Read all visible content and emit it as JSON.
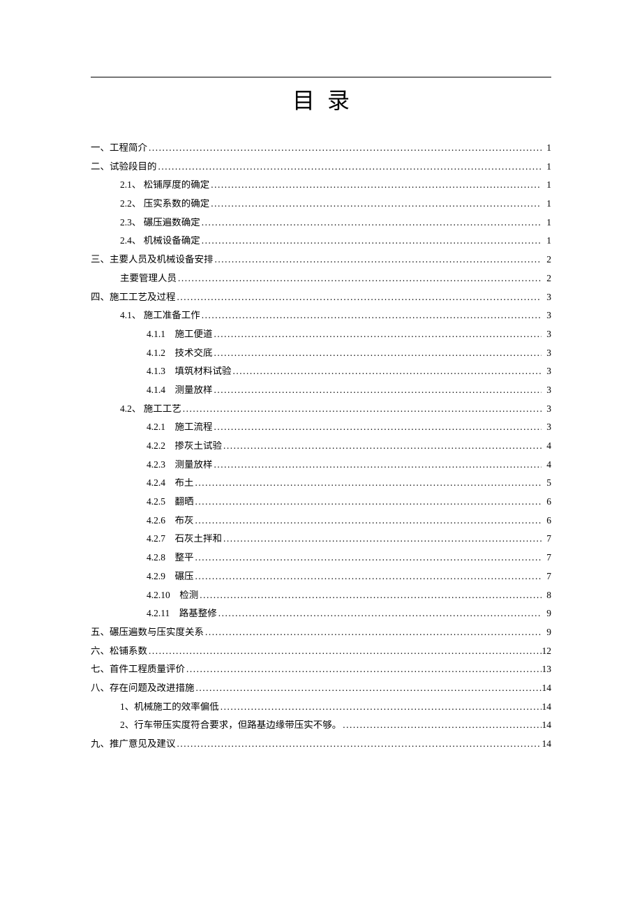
{
  "title": "目录",
  "toc": [
    {
      "level": 0,
      "label": "一、工程简介",
      "page": "1"
    },
    {
      "level": 0,
      "label": "二、试验段目的",
      "page": "1"
    },
    {
      "level": 1,
      "label": "2.1、 松铺厚度的确定",
      "page": "1"
    },
    {
      "level": 1,
      "label": "2.2、 压实系数的确定",
      "page": "1"
    },
    {
      "level": 1,
      "label": "2.3、 碾压遍数确定",
      "page": "1"
    },
    {
      "level": 1,
      "label": "2.4、 机械设备确定",
      "page": "1"
    },
    {
      "level": 0,
      "label": "三、主要人员及机械设备安排",
      "page": "2"
    },
    {
      "level": 1,
      "label": "主要管理人员",
      "page": "2"
    },
    {
      "level": 0,
      "label": "四、施工工艺及过程",
      "page": "3"
    },
    {
      "level": 1,
      "label": "4.1、  施工准备工作",
      "page": "3"
    },
    {
      "level": 2,
      "label": "4.1.1　施工便道",
      "page": "3"
    },
    {
      "level": 2,
      "label": "4.1.2　技术交底",
      "page": "3"
    },
    {
      "level": 2,
      "label": "4.1.3　填筑材料试验",
      "page": "3"
    },
    {
      "level": 2,
      "label": "4.1.4　测量放样",
      "page": "3"
    },
    {
      "level": 1,
      "label": "4.2、  施工工艺",
      "page": "3"
    },
    {
      "level": 2,
      "label": "4.2.1　施工流程",
      "page": "3"
    },
    {
      "level": 2,
      "label": "4.2.2　掺灰土试验",
      "page": "4"
    },
    {
      "level": 2,
      "label": "4.2.3　测量放样",
      "page": "4"
    },
    {
      "level": 2,
      "label": "4.2.4　布土",
      "page": "5"
    },
    {
      "level": 2,
      "label": "4.2.5　翻晒",
      "page": "6"
    },
    {
      "level": 2,
      "label": "4.2.6　布灰",
      "page": "6"
    },
    {
      "level": 2,
      "label": "4.2.7　石灰土拌和",
      "page": "7"
    },
    {
      "level": 2,
      "label": "4.2.8　整平",
      "page": "7"
    },
    {
      "level": 2,
      "label": "4.2.9　碾压",
      "page": "7"
    },
    {
      "level": 2,
      "label": "4.2.10　检测",
      "page": "8"
    },
    {
      "level": 2,
      "label": "4.2.11　路基整修",
      "page": "9"
    },
    {
      "level": 0,
      "label": "五、碾压遍数与压实度关系",
      "page": "9"
    },
    {
      "level": 0,
      "label": "六、松铺系数",
      "page": "12"
    },
    {
      "level": 0,
      "label": "七、首件工程质量评价",
      "page": "13"
    },
    {
      "level": 0,
      "label": "八、存在问题及改进措施",
      "page": "14"
    },
    {
      "level": 1,
      "label": "1、机械施工的效率偏低",
      "page": "14"
    },
    {
      "level": 1,
      "label": "2、行车带压实度符合要求，但路基边缘带压实不够。",
      "page": "14"
    },
    {
      "level": 0,
      "label": "九、推广意见及建议",
      "page": "14"
    }
  ]
}
